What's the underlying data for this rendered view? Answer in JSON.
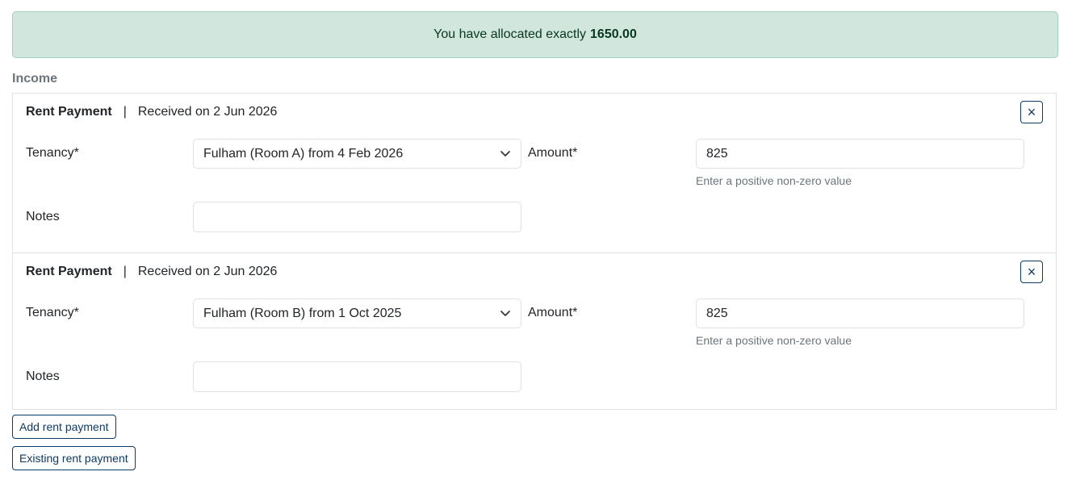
{
  "alert": {
    "text": "You have allocated exactly",
    "amount": "1650.00"
  },
  "section": {
    "title": "Income"
  },
  "payments": [
    {
      "kind": "Rent Payment",
      "separator": "|",
      "received": "Received on 2 Jun 2026",
      "close_icon": "×",
      "tenancy_label": "Tenancy*",
      "tenancy_value": "Fulham (Room A) from 4 Feb 2026",
      "amount_label": "Amount*",
      "amount_value": "825",
      "amount_hint": "Enter a positive non-zero value",
      "notes_label": "Notes",
      "notes_value": ""
    },
    {
      "kind": "Rent Payment",
      "separator": "|",
      "received": "Received on 2 Jun 2026",
      "close_icon": "×",
      "tenancy_label": "Tenancy*",
      "tenancy_value": "Fulham (Room B) from 1 Oct 2025",
      "amount_label": "Amount*",
      "amount_value": "825",
      "amount_hint": "Enter a positive non-zero value",
      "notes_label": "Notes",
      "notes_value": ""
    }
  ],
  "actions": {
    "add_label": "Add rent payment",
    "existing_label": "Existing rent payment"
  },
  "colors": {
    "success_bg": "#d1e7dd",
    "primary": "#0d3b66",
    "muted": "#6c757d"
  }
}
